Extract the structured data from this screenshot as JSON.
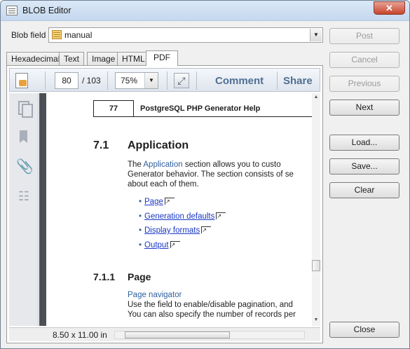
{
  "window": {
    "title": "BLOB Editor",
    "close_symbol": "✕"
  },
  "blob_field": {
    "label": "Blob field",
    "value": "manual",
    "icon": "database-table-icon"
  },
  "tabs": [
    {
      "label": "Hexadecimal"
    },
    {
      "label": "Text"
    },
    {
      "label": "Image"
    },
    {
      "label": "HTML"
    },
    {
      "label": "PDF"
    }
  ],
  "pdf_toolbar": {
    "current_page": "80",
    "total_pages": "/ 103",
    "zoom": "75%",
    "comment_label": "Comment",
    "share_label": "Share"
  },
  "pdf_page": {
    "page_number": "77",
    "running_head": "PostgreSQL PHP Generator Help",
    "section_number": "7.1",
    "section_title": "Application",
    "para1_line1_pre": "The ",
    "para1_line1_link": "Application",
    "para1_line1_post": " section allows you to custo",
    "para1_line2": "Generator behavior. The section consists of se",
    "para1_line3": "about each of them.",
    "bullets": [
      "Page",
      "Generation defaults",
      "Display formats",
      "Output"
    ],
    "subsection_number": "7.1.1",
    "subsection_title": "Page",
    "sub_heading": "Page navigator",
    "para2_line1": "Use the field to enable/disable pagination, and",
    "para2_line2": "You can also specify the number of records per"
  },
  "status": {
    "page_size": "8.50 x 11.00 in"
  },
  "buttons": {
    "post": "Post",
    "cancel": "Cancel",
    "previous": "Previous",
    "next": "Next",
    "load": "Load...",
    "save": "Save...",
    "clear": "Clear",
    "close": "Close"
  }
}
